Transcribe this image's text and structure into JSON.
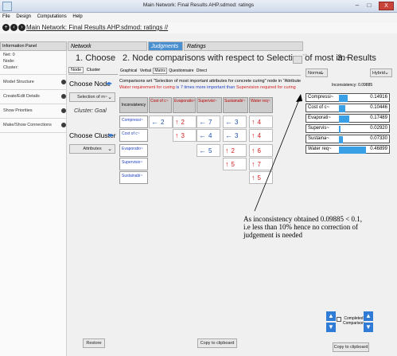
{
  "window": {
    "title": "Main Network: Final Results AHP.sdmod: ratings",
    "close_glyph": "X",
    "min_glyph": "–",
    "max_glyph": "□"
  },
  "menu": [
    "File",
    "Design",
    "Computations",
    "Help"
  ],
  "breadcrumb": "Main Network: Final Results AHP.sdmod: ratings //",
  "headers": {
    "info_panel": "Information Panel",
    "network": "Network",
    "judgments": "Judgments",
    "ratings": "Ratings"
  },
  "left_panel": {
    "net": "Net: 0",
    "node": "Node:",
    "cluster": "Cluster:",
    "items": [
      "Model Structure",
      "Create/Edit Details",
      "Show Priorities",
      "Make/Show Connections"
    ]
  },
  "choose": {
    "title": "1. Choose",
    "tabs": [
      "Node",
      "Cluster"
    ],
    "choose_node": "Choose Node",
    "node_select": "Selection of m~",
    "cluster_label": "Cluster: Goal",
    "choose_cluster": "Choose Cluster",
    "cluster_select": "Attributes",
    "restore": "Restore"
  },
  "comparisons": {
    "title": "2. Node comparisons with respect to Selection of most im~",
    "tabs": [
      "Graphical",
      "Verbal",
      "Matrix",
      "Questionnaire",
      "Direct"
    ],
    "line1": "Comparisons wrt \"Selection of most important attributes for concrete curing\" node in \"Attribute",
    "line2_red1": "Water requirement for curing",
    "line2_blue": "is 7 times more important than",
    "line2_red2": "Supervision required for curing",
    "inconsistency_label": "Inconsistency",
    "col_headers": [
      "Cost of c~",
      "Evaporatio~",
      "Supervisi~",
      "Sustainabi~",
      "Water req~"
    ],
    "row_headers": [
      "Compressi~",
      "Cost of c~",
      "Evaporatio~",
      "Supervisio~",
      "Sustainabi~"
    ],
    "cells": [
      [
        {
          "a": "←",
          "v": "2",
          "c": "blue"
        },
        {
          "a": "↑",
          "v": "2",
          "c": "red"
        },
        {
          "a": "←",
          "v": "7",
          "c": "blue"
        },
        {
          "a": "←",
          "v": "3",
          "c": "blue"
        },
        {
          "a": "↑",
          "v": "4",
          "c": "red"
        }
      ],
      [
        null,
        {
          "a": "↑",
          "v": "3",
          "c": "red"
        },
        {
          "a": "←",
          "v": "4",
          "c": "blue"
        },
        {
          "a": "←",
          "v": "3",
          "c": "blue"
        },
        {
          "a": "↑",
          "v": "4",
          "c": "red"
        }
      ],
      [
        null,
        null,
        {
          "a": "←",
          "v": "5",
          "c": "blue"
        },
        {
          "a": "↑",
          "v": "2",
          "c": "red"
        },
        {
          "a": "↑",
          "v": "6",
          "c": "red"
        }
      ],
      [
        null,
        null,
        null,
        {
          "a": "↑",
          "v": "5",
          "c": "red"
        },
        {
          "a": "↑",
          "v": "7",
          "c": "red"
        }
      ],
      [
        null,
        null,
        null,
        null,
        {
          "a": "↑",
          "v": "5",
          "c": "red"
        }
      ]
    ],
    "copy": "Copy to clipboard"
  },
  "results": {
    "title": "3. Results",
    "normal": "Normal",
    "hybrid": "Hybrid",
    "inconsistency": "Inconsistency: 0.09885",
    "rows": [
      {
        "label": "Compressi~",
        "value": "0.14916",
        "frac": 0.14916
      },
      {
        "label": "Cost of c~",
        "value": "0.10446",
        "frac": 0.10446
      },
      {
        "label": "Evaporati~",
        "value": "0.17489",
        "frac": 0.17489
      },
      {
        "label": "Supervis~",
        "value": "0.02920",
        "frac": 0.0292
      },
      {
        "label": "Sustaina~",
        "value": "0.07330",
        "frac": 0.0733
      },
      {
        "label": "Water req~",
        "value": "0.46899",
        "frac": 0.46899
      }
    ],
    "completed": "Completed",
    "comparison": "Comparison",
    "copy": "Copy to clipboard"
  },
  "annotation": "As inconsistency obtained 0.09885 < 0.1, i.e less than 10% hence no correction of judgement is needed"
}
